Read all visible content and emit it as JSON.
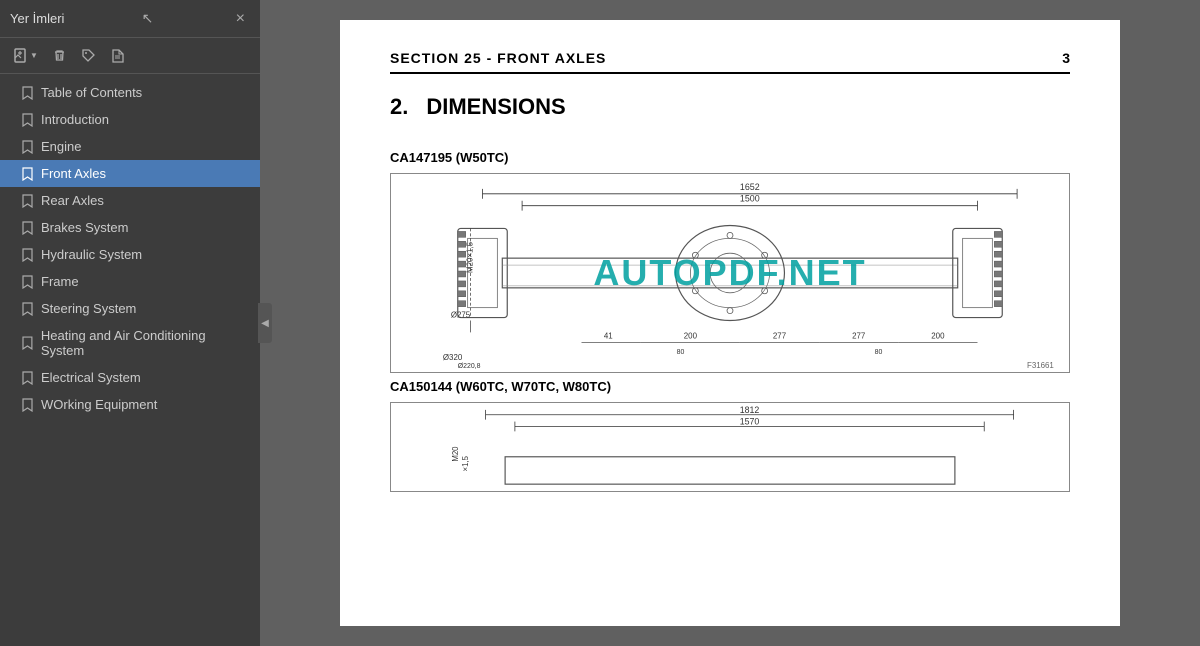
{
  "sidebar": {
    "title": "Yer İmleri",
    "close_label": "×",
    "toolbar": {
      "add_label": "⊞",
      "delete_label": "🗑",
      "bookmark1_label": "🔖",
      "bookmark2_label": "🔖"
    },
    "items": [
      {
        "label": "Table of Contents",
        "active": false
      },
      {
        "label": "Introduction",
        "active": false
      },
      {
        "label": "Engine",
        "active": false
      },
      {
        "label": "Front Axles",
        "active": true
      },
      {
        "label": "Rear Axles",
        "active": false
      },
      {
        "label": "Brakes System",
        "active": false
      },
      {
        "label": "Hydraulic System",
        "active": false
      },
      {
        "label": "Frame",
        "active": false
      },
      {
        "label": "Steering System",
        "active": false
      },
      {
        "label": "Heating and Air Conditioning System",
        "active": false
      },
      {
        "label": "Electrical System",
        "active": false
      },
      {
        "label": "WOrking Equipment",
        "active": false
      }
    ]
  },
  "page": {
    "section_title": "SECTION 25 - FRONT AXLES",
    "page_number": "3",
    "heading_num": "2.",
    "heading_text": "DIMENSIONS",
    "model1_label": "CA147195 (W50TC)",
    "diagram1_ref": "F31661",
    "model2_label": "CA150144 (W60TC, W70TC, W80TC)",
    "watermark": "AUTOPDF.NET"
  },
  "icons": {
    "cursor": "↖",
    "collapse": "◀",
    "bookmark": "🔖"
  }
}
